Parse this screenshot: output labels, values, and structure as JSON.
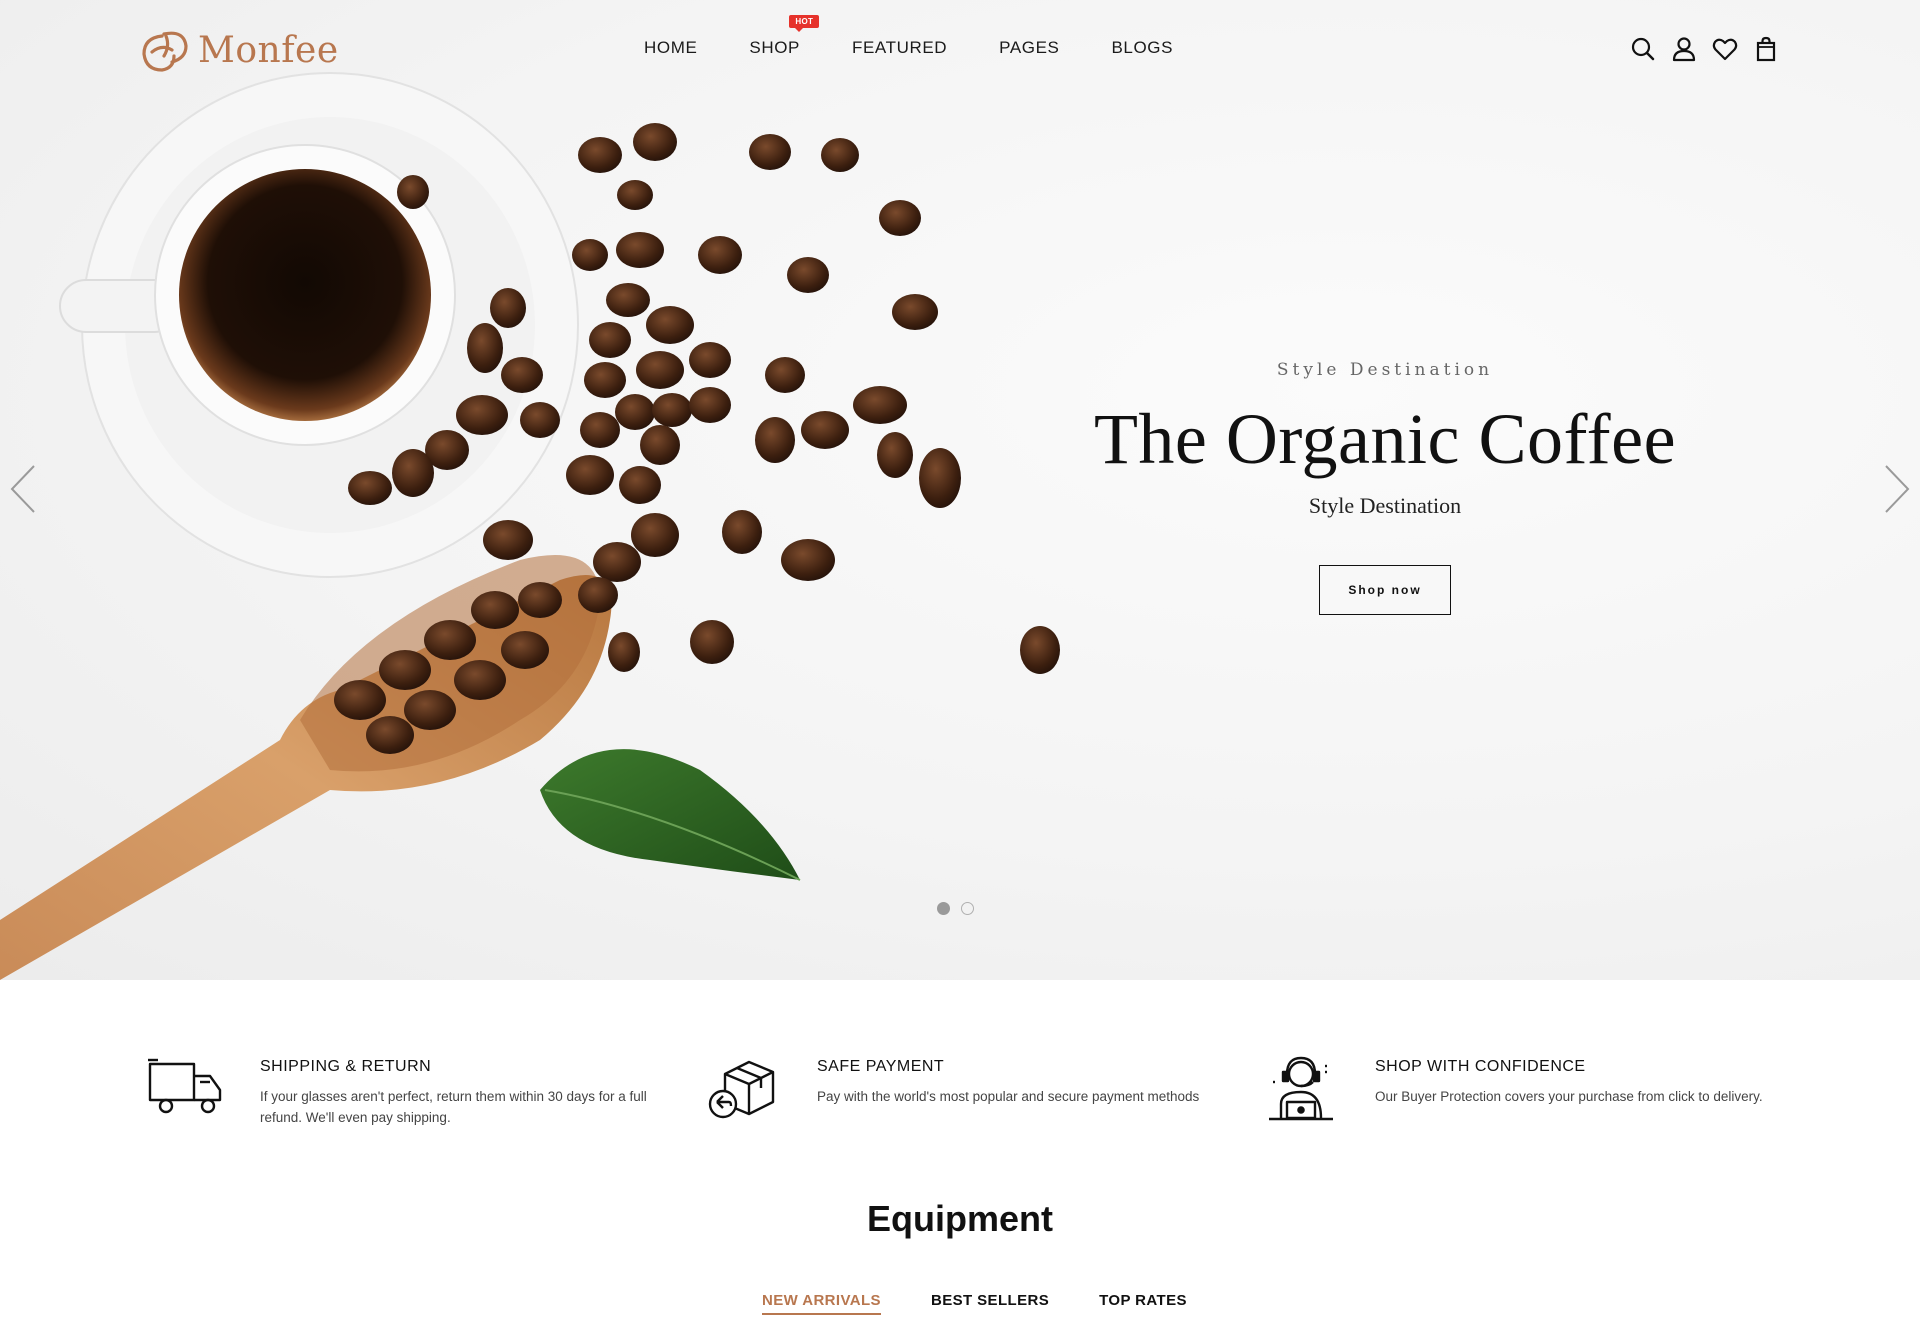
{
  "brand": {
    "name": "Monfee",
    "accent_color": "#b8774f"
  },
  "nav": {
    "items": [
      {
        "label": "HOME"
      },
      {
        "label": "SHOP",
        "badge": "HOT"
      },
      {
        "label": "FEATURED"
      },
      {
        "label": "PAGES"
      },
      {
        "label": "BLOGS"
      }
    ]
  },
  "header_icons": [
    "search-icon",
    "user-icon",
    "heart-icon",
    "shopping-bag-icon"
  ],
  "hero": {
    "kicker": "Style Destination",
    "title": "The Organic Coffee",
    "subtitle": "Style Destination",
    "button_label": "Shop now",
    "slides_total": 2,
    "active_slide": 1
  },
  "features": [
    {
      "icon": "truck-icon",
      "title": "SHIPPING & RETURN",
      "desc": "If your glasses aren't perfect, return them within 30 days for a full refund. We'll even pay shipping."
    },
    {
      "icon": "box-return-icon",
      "title": "SAFE PAYMENT",
      "desc": "Pay with the world's most popular and secure payment methods"
    },
    {
      "icon": "support-agent-icon",
      "title": "SHOP WITH CONFIDENCE",
      "desc": "Our Buyer Protection covers your purchase from click to delivery."
    }
  ],
  "equipment": {
    "title": "Equipment",
    "tabs": [
      {
        "label": "NEW ARRIVALS",
        "active": true
      },
      {
        "label": "BEST SELLERS",
        "active": false
      },
      {
        "label": "TOP RATES",
        "active": false
      }
    ]
  }
}
